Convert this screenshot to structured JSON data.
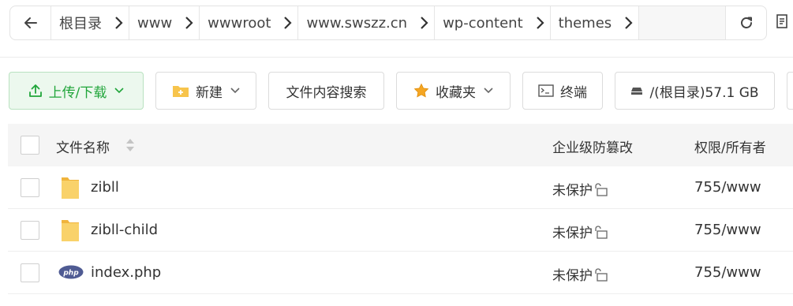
{
  "breadcrumb": {
    "items": [
      {
        "label": "根目录"
      },
      {
        "label": "www"
      },
      {
        "label": "wwwroot"
      },
      {
        "label": "www.swszz.cn"
      },
      {
        "label": "wp-content"
      },
      {
        "label": "themes"
      }
    ]
  },
  "toolbar": {
    "upload_label": "上传/下载",
    "new_label": "新建",
    "search_label": "文件内容搜索",
    "favorites_label": "收藏夹",
    "terminal_label": "终端",
    "disk_label": "/(根目录)57.1 GB"
  },
  "table": {
    "headers": {
      "name": "文件名称",
      "protect": "企业级防篡改",
      "permission": "权限/所有者"
    },
    "rows": [
      {
        "name": "zibll",
        "type": "folder",
        "protect": "未保护",
        "permission": "755/www"
      },
      {
        "name": "zibll-child",
        "type": "folder",
        "protect": "未保护",
        "permission": "755/www"
      },
      {
        "name": "index.php",
        "type": "php",
        "protect": "未保护",
        "permission": "755/www"
      }
    ]
  },
  "icons": {
    "back": "arrow-left-icon",
    "separator": "chevron-right-icon",
    "refresh": "refresh-icon",
    "upload": "upload-icon",
    "folder": "folder-icon",
    "star": "star-icon",
    "terminal": "terminal-icon",
    "disk": "disk-icon",
    "lock": "lock-icon"
  },
  "colors": {
    "accent_green": "#20a53a",
    "folder_yellow": "#f7c44c",
    "php_blue": "#4f5b93"
  }
}
